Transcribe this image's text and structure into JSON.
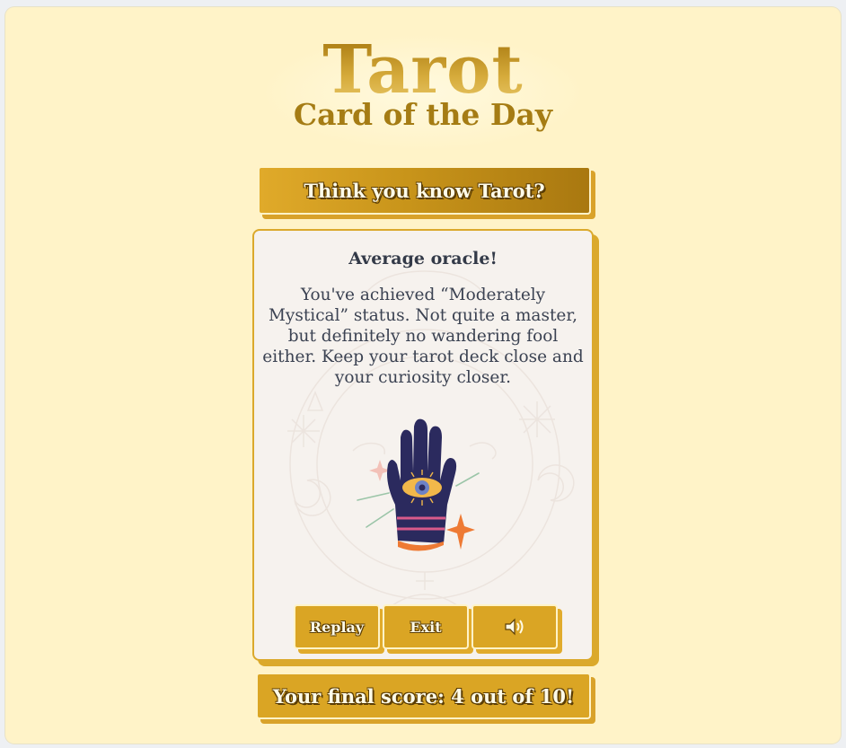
{
  "logo": {
    "title": "Tarot",
    "subtitle": "Card of the Day"
  },
  "banner": {
    "text": "Think you know Tarot?"
  },
  "result": {
    "heading": "Average oracle!",
    "message": "You've achieved “Moderately Mystical” status. Not quite a master, but definitely no wandering fool either. Keep your tarot deck close and your curiosity closer.",
    "illustration": "hand-with-eye-icon"
  },
  "controls": {
    "replay_label": "Replay",
    "exit_label": "Exit",
    "sound_icon": "speaker-icon"
  },
  "score": {
    "text": "Your final score: 4 out of 10!"
  },
  "colors": {
    "page_background": "#fff3c8",
    "accent_gold": "#daa524",
    "card_background": "#f6f2ee",
    "text_dark": "#333a48"
  }
}
